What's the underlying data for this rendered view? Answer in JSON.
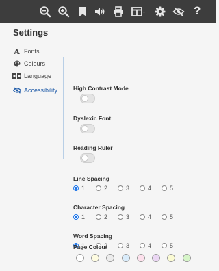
{
  "toolbar": {
    "icons": [
      "zoom-out-icon",
      "zoom-in-icon",
      "bookmark-icon",
      "audio-icon",
      "print-icon",
      "layout-icon",
      "gear-icon",
      "accessibility-icon",
      "help-icon"
    ],
    "help_label": "?",
    "layout_caret": "-"
  },
  "settings": {
    "title": "Settings"
  },
  "sidebar": {
    "items": [
      {
        "label": "Fonts",
        "icon": "font-icon",
        "active": false
      },
      {
        "label": "Colours",
        "icon": "palette-icon",
        "active": false
      },
      {
        "label": "Language",
        "icon": "language-icon",
        "active": false
      },
      {
        "label": "Accessibility",
        "icon": "accessibility-icon",
        "active": true
      }
    ],
    "font_glyph": "A"
  },
  "panel": {
    "high_contrast": {
      "label": "High Contrast Mode",
      "on": false
    },
    "dyslexic_font": {
      "label": "Dyslexic Font",
      "on": false
    },
    "reading_ruler": {
      "label": "Reading Ruler",
      "on": false
    },
    "line_spacing": {
      "label": "Line Spacing",
      "options": [
        "1",
        "2",
        "3",
        "4",
        "5"
      ],
      "selected": "1"
    },
    "character_spacing": {
      "label": "Character Spacing",
      "options": [
        "1",
        "2",
        "3",
        "4",
        "5"
      ],
      "selected": "1"
    },
    "word_spacing": {
      "label": "Word Spacing",
      "options": [
        "1",
        "2",
        "3",
        "4",
        "5"
      ],
      "selected": "1"
    },
    "page_colour": {
      "label": "Page Colour",
      "swatches": [
        "#ffffff",
        "#fdfbe0",
        "#ececec",
        "#d9ecfb",
        "#fde0ec",
        "#ead6f3",
        "#fafad2",
        "#d6f5c8"
      ]
    }
  },
  "colors": {
    "toolbar_bg": "#3d3d3d",
    "accent": "#1a73e8",
    "active_link": "#1e5aa8"
  }
}
